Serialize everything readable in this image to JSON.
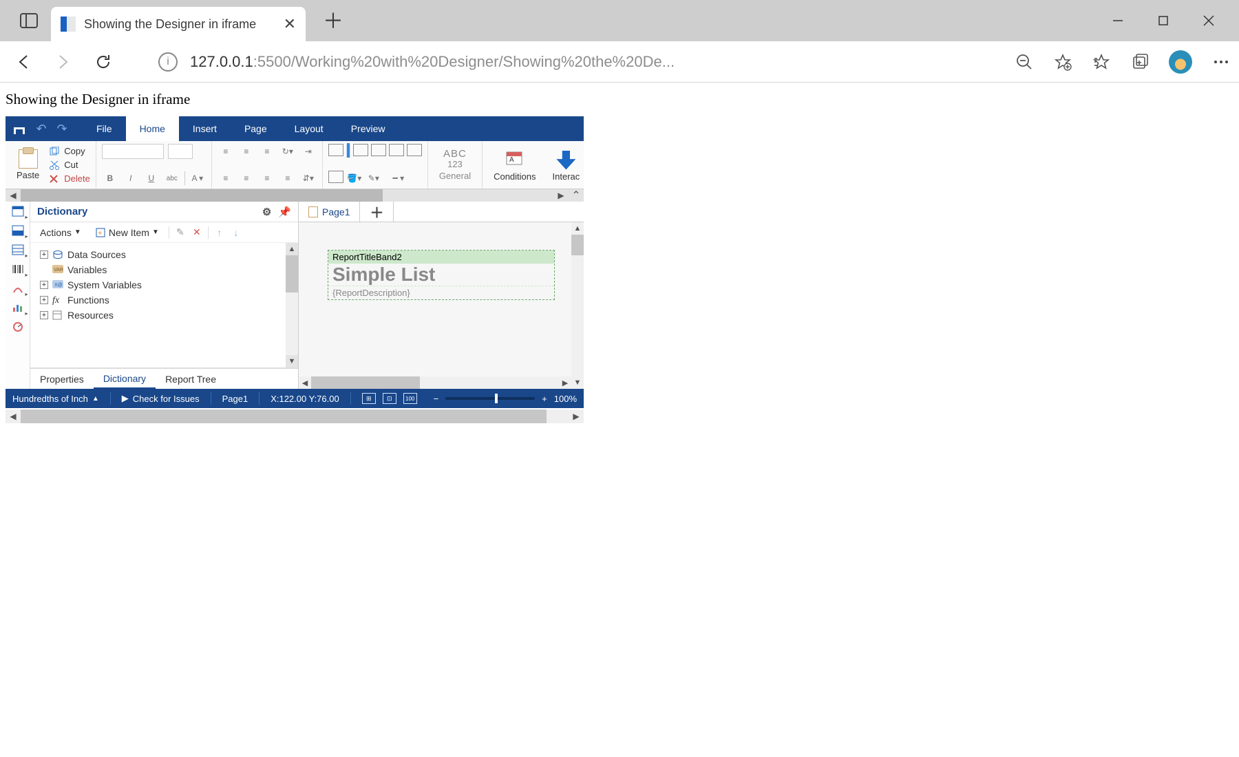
{
  "browser": {
    "tab_title": "Showing the Designer in iframe",
    "url_host": "127.0.0.1",
    "url_port": ":5500",
    "url_path": "/Working%20with%20Designer/Showing%20the%20De..."
  },
  "page": {
    "heading": "Showing the Designer in iframe"
  },
  "ribbon": {
    "tabs": [
      "File",
      "Home",
      "Insert",
      "Page",
      "Layout",
      "Preview"
    ],
    "active": "Home",
    "paste": "Paste",
    "copy": "Copy",
    "cut": "Cut",
    "delete": "Delete",
    "format_abc": "ABC",
    "format_123": "123",
    "format_general": "General",
    "conditions": "Conditions",
    "interaction": "Interac"
  },
  "panel": {
    "title": "Dictionary",
    "actions": "Actions",
    "new_item": "New Item",
    "tree": [
      {
        "label": "Data Sources",
        "expandable": true
      },
      {
        "label": "Variables",
        "expandable": false
      },
      {
        "label": "System Variables",
        "expandable": true
      },
      {
        "label": "Functions",
        "expandable": true
      },
      {
        "label": "Resources",
        "expandable": true
      }
    ],
    "tabs": [
      "Properties",
      "Dictionary",
      "Report Tree"
    ],
    "active_tab": "Dictionary"
  },
  "canvas": {
    "page_tab": "Page1",
    "band_name": "ReportTitleBand2",
    "title_text": "Simple List",
    "desc_text": "{ReportDescription}"
  },
  "status": {
    "units": "Hundredths of Inch",
    "check": "Check for Issues",
    "page": "Page1",
    "coords": "X:122.00 Y:76.00",
    "zoom": "100%"
  }
}
